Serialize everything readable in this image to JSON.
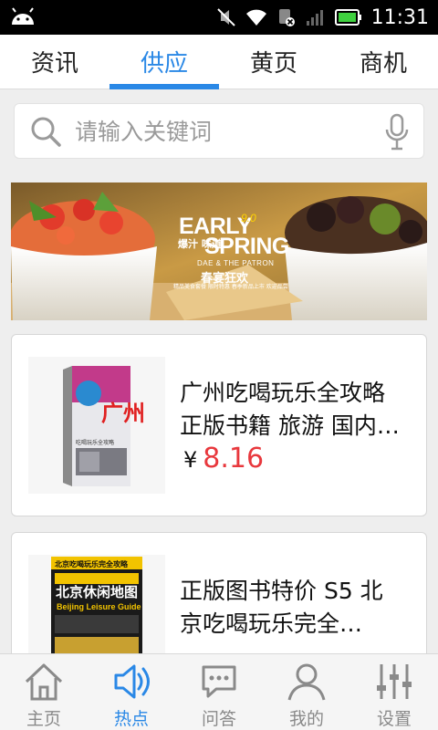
{
  "status_bar": {
    "time": "11:31"
  },
  "tabs": [
    {
      "label": "资讯",
      "active": false
    },
    {
      "label": "供应",
      "active": true
    },
    {
      "label": "黄页",
      "active": false
    },
    {
      "label": "商机",
      "active": false
    }
  ],
  "search": {
    "placeholder": "请输入关键词",
    "value": ""
  },
  "banner": {
    "title_line1": "EARLY",
    "badge": "9.0",
    "cn_tag": "爆汁 味道",
    "title_line2": "SPRING",
    "subtitle": "DAE & THE PATRON",
    "cn_caption": "春宴狂欢",
    "small_text": "精品美食套餐 限时特惠 春季新品上市 欢迎品尝"
  },
  "products": [
    {
      "title_line1": "广州吃喝玩乐全攻略",
      "title_line2": "正版书籍 旅游 国内…",
      "currency": "¥",
      "price": "8.16"
    },
    {
      "title_line1": "正版图书特价 S5 北",
      "title_line2": "京吃喝玩乐完全…",
      "currency": "¥",
      "price": ""
    }
  ],
  "bottom_nav": [
    {
      "label": "主页",
      "icon": "home-icon",
      "active": false
    },
    {
      "label": "热点",
      "icon": "speaker-icon",
      "active": true
    },
    {
      "label": "问答",
      "icon": "chat-icon",
      "active": false
    },
    {
      "label": "我的",
      "icon": "user-icon",
      "active": false
    },
    {
      "label": "设置",
      "icon": "sliders-icon",
      "active": false
    }
  ],
  "colors": {
    "accent": "#2a88e6",
    "price": "#e8383d",
    "background": "#eeeeee"
  },
  "book_covers": [
    {
      "big_text": "广州",
      "small_text": "吃喝玩乐全攻略"
    },
    {
      "top_text": "北京吃喝玩乐完全攻略",
      "big_text": "北京休闲地图",
      "en_text": "Beijing Leisure Guide"
    }
  ]
}
